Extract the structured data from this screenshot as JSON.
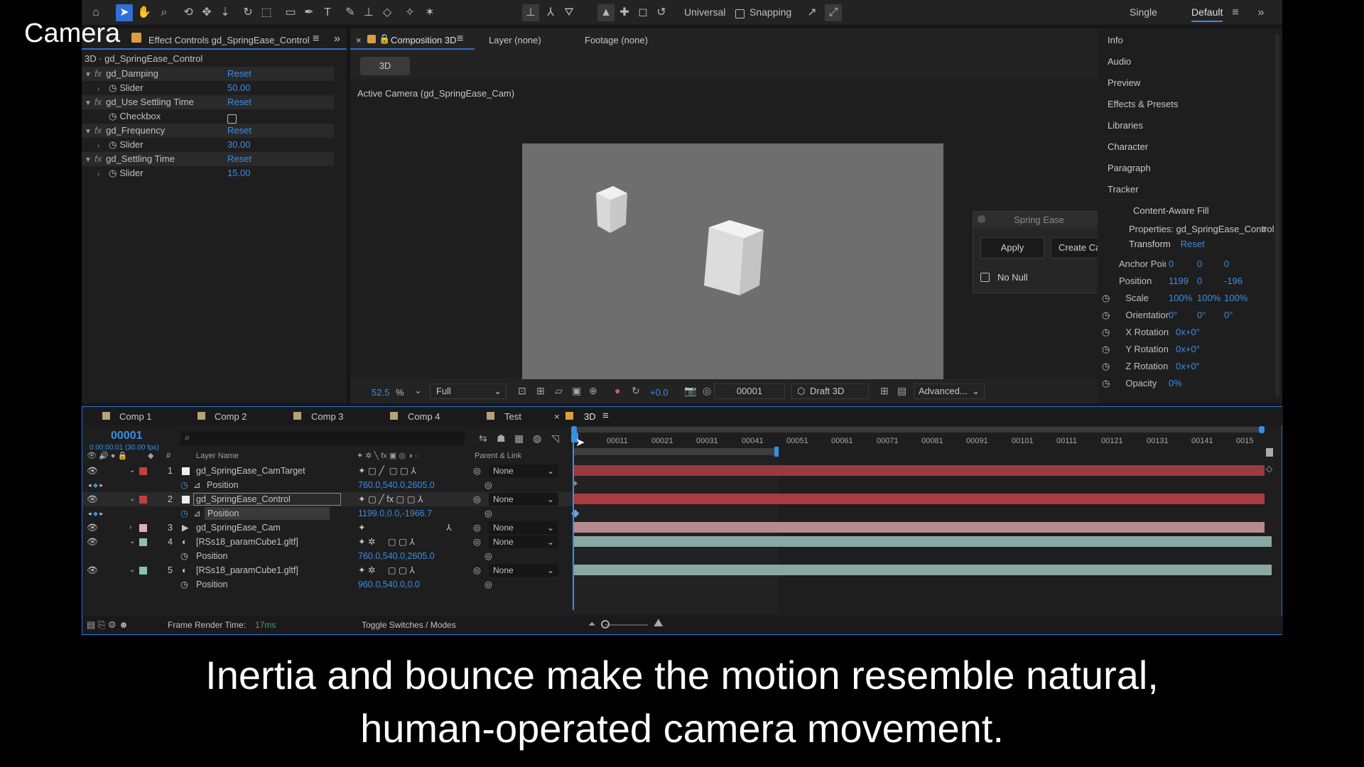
{
  "overlay_title": "Camera",
  "subtitle_line1": "Inertia and bounce make the motion resemble natural,",
  "subtitle_line2": "human-operated camera movement.",
  "toolbar": {
    "axis_mode": "Universal",
    "snapping": "Snapping",
    "workspace_single": "Single",
    "workspace_default": "Default"
  },
  "effect_controls": {
    "tab_label": "Effect Controls gd_SpringEase_Control",
    "layer_path": "3D · gd_SpringEase_Control",
    "effects": [
      {
        "name": "gd_Damping",
        "reset": "Reset",
        "param": "Slider",
        "value": "50.00"
      },
      {
        "name": "gd_Use Settling Time",
        "reset": "Reset",
        "param": "Checkbox",
        "value": ""
      },
      {
        "name": "gd_Frequency",
        "reset": "Reset",
        "param": "Slider",
        "value": "30.00"
      },
      {
        "name": "gd_Settling Time",
        "reset": "Reset",
        "param": "Slider",
        "value": "15.00"
      }
    ]
  },
  "composition": {
    "tab_label": "Composition 3D",
    "layer_tab": "Layer (none)",
    "footage_tab": "Footage (none)",
    "comp_button": "3D",
    "camera_label": "Active Camera (gd_SpringEase_Cam)",
    "zoom": "52.5",
    "zoom_unit": "%",
    "resolution": "Full",
    "exposure": "+0.0",
    "timecode": "00001",
    "renderer": "Draft 3D",
    "view_mode": "Advanced..."
  },
  "spring_ease": {
    "title": "Spring Ease",
    "apply": "Apply",
    "create_cam": "Create Cam",
    "no_null": "No Null"
  },
  "right_panel": {
    "items": [
      "Info",
      "Audio",
      "Preview",
      "Effects & Presets",
      "Libraries",
      "Character",
      "Paragraph",
      "Tracker",
      "Content-Aware Fill"
    ],
    "properties_title": "Properties: gd_SpringEase_Control",
    "transform": "Transform",
    "reset": "Reset",
    "props": [
      {
        "name": "Anchor Point",
        "v1": "0",
        "v2": "0",
        "v3": "0"
      },
      {
        "name": "Position",
        "v1": "1199",
        "v2": "0",
        "v3": "-196"
      },
      {
        "name": "Scale",
        "v1": "100%",
        "v2": "100%",
        "v3": "100%"
      },
      {
        "name": "Orientation",
        "v1": "0°",
        "v2": "0°",
        "v3": "0°"
      },
      {
        "name": "X Rotation",
        "v1": "0x+0°",
        "v2": "",
        "v3": ""
      },
      {
        "name": "Y Rotation",
        "v1": "0x+0°",
        "v2": "",
        "v3": ""
      },
      {
        "name": "Z Rotation",
        "v1": "0x+0°",
        "v2": "",
        "v3": ""
      },
      {
        "name": "Opacity",
        "v1": "0%",
        "v2": "",
        "v3": ""
      }
    ]
  },
  "timeline": {
    "comp_tabs": [
      "Comp 1",
      "Comp 2",
      "Comp 3",
      "Comp 4",
      "Test",
      "3D"
    ],
    "timecode": "00001",
    "timecode_sub": "0:00:00:01 (30.00 fps)",
    "search_placeholder": "",
    "col_layer_name": "Layer Name",
    "col_parent": "Parent & Link",
    "ruler": [
      "00011",
      "00021",
      "00031",
      "00041",
      "00051",
      "00061",
      "00071",
      "00081",
      "00091",
      "00101",
      "00111",
      "00121",
      "00131",
      "00141",
      "0015"
    ],
    "rows": [
      {
        "num": "1",
        "name": "gd_SpringEase_CamTarget",
        "parent": "None",
        "kind": "layer"
      },
      {
        "num": "",
        "name": "Position",
        "value": "760.0,540.0,2605.0",
        "kind": "prop"
      },
      {
        "num": "2",
        "name": "gd_SpringEase_Control",
        "parent": "None",
        "kind": "layer"
      },
      {
        "num": "",
        "name": "Position",
        "value": "1199.0,0.0,-1966.7",
        "kind": "prop"
      },
      {
        "num": "3",
        "name": "gd_SpringEase_Cam",
        "parent": "None",
        "kind": "layer"
      },
      {
        "num": "4",
        "name": "[RSs18_paramCube1.gltf]",
        "parent": "None",
        "kind": "layer"
      },
      {
        "num": "",
        "name": "Position",
        "value": "760.0,540.0,2605.0",
        "kind": "prop"
      },
      {
        "num": "5",
        "name": "[RSs18_paramCube1.gltf]",
        "parent": "None",
        "kind": "layer"
      },
      {
        "num": "",
        "name": "Position",
        "value": "960.0,540.0,0.0",
        "kind": "prop"
      }
    ],
    "frame_render_label": "Frame Render Time:",
    "frame_render_value": "17ms",
    "toggle_label": "Toggle Switches / Modes"
  },
  "colors": {
    "accent": "#3a8ee6",
    "bar_red": "#9a3a3e",
    "bar_pink": "#b58b90",
    "bar_teal": "#8aa7a3"
  }
}
